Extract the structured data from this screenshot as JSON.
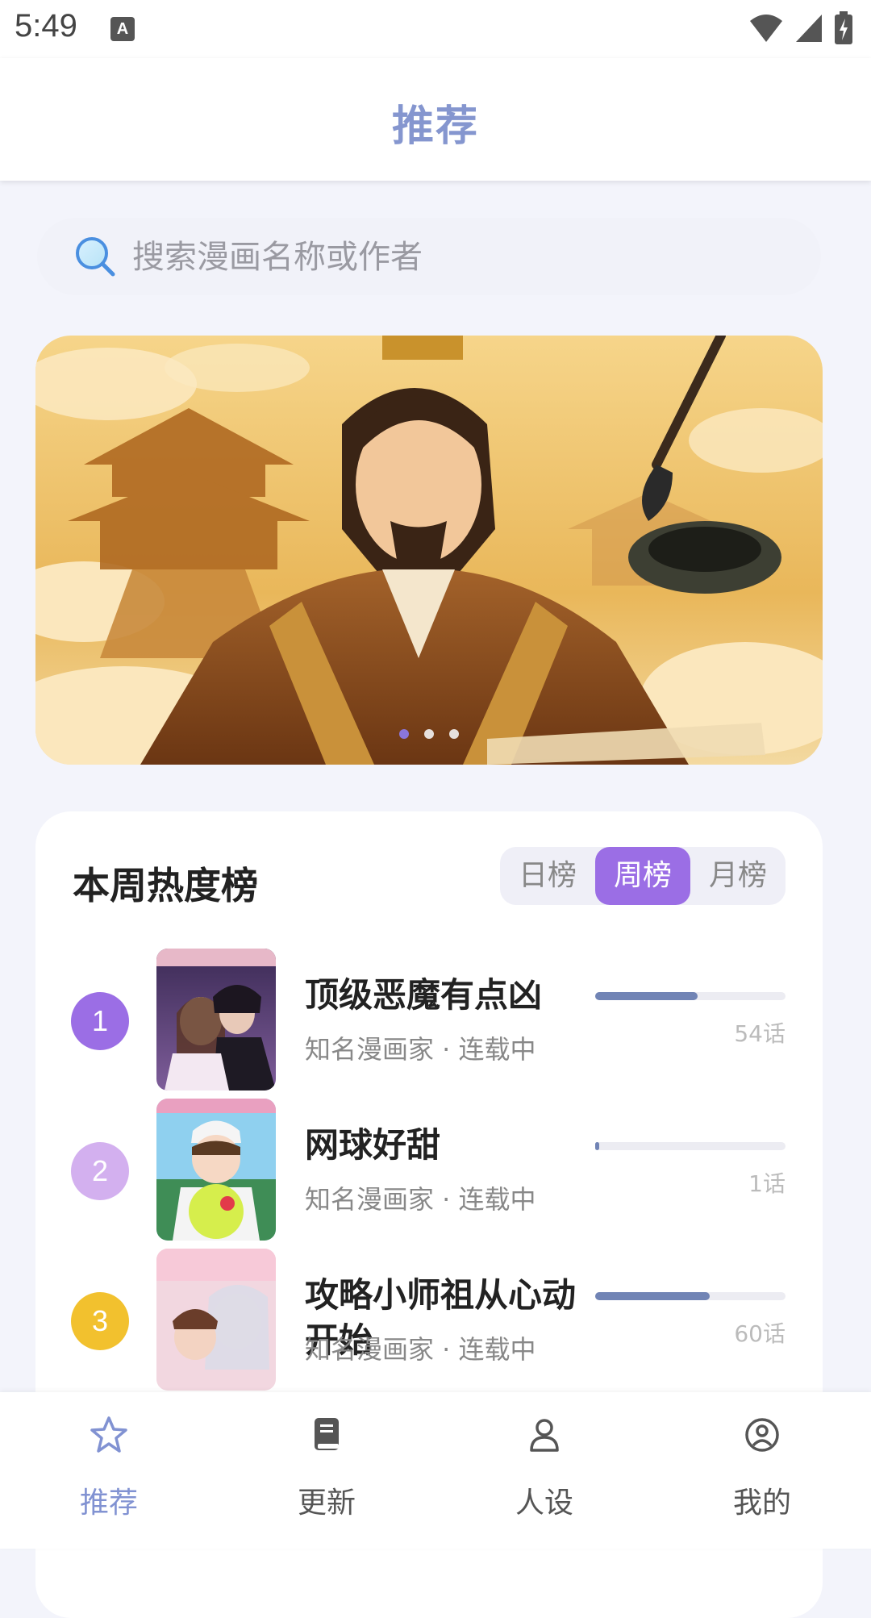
{
  "status_bar": {
    "time": "5:49",
    "notification_icon": "a-letter-icon"
  },
  "header": {
    "title": "推荐"
  },
  "search": {
    "placeholder": "搜索漫画名称或作者"
  },
  "banner": {
    "page_count": 3,
    "active_page": 1
  },
  "ranking": {
    "title": "本周热度榜",
    "tabs": [
      {
        "label": "日榜",
        "selected": false
      },
      {
        "label": "周榜",
        "selected": true
      },
      {
        "label": "月榜",
        "selected": false
      }
    ],
    "items": [
      {
        "rank": "1",
        "title": "顶级恶魔有点凶",
        "subtitle": "知名漫画家 · 连载中",
        "episodes": "54话",
        "popularity": 0.54,
        "rank_color": "#9b6ee5"
      },
      {
        "rank": "2",
        "title": "网球好甜",
        "subtitle": "知名漫画家 · 连载中",
        "episodes": "1话",
        "popularity": 0.01,
        "rank_color": "#d3b0ef"
      },
      {
        "rank": "3",
        "title": "攻略小师祖从心动开始",
        "subtitle": "知名漫画家 · 连载中",
        "episodes": "60话",
        "popularity": 0.6,
        "rank_color": "#f2c12e"
      }
    ]
  },
  "bottom_nav": [
    {
      "label": "推荐",
      "icon": "star-icon",
      "active": true
    },
    {
      "label": "更新",
      "icon": "book-icon",
      "active": false
    },
    {
      "label": "人设",
      "icon": "person-icon",
      "active": false
    },
    {
      "label": "我的",
      "icon": "profile-circle-icon",
      "active": false
    }
  ],
  "colors": {
    "accent": "#9b6ee5",
    "title_blue": "#8596cf",
    "progress": "#7184b5"
  }
}
